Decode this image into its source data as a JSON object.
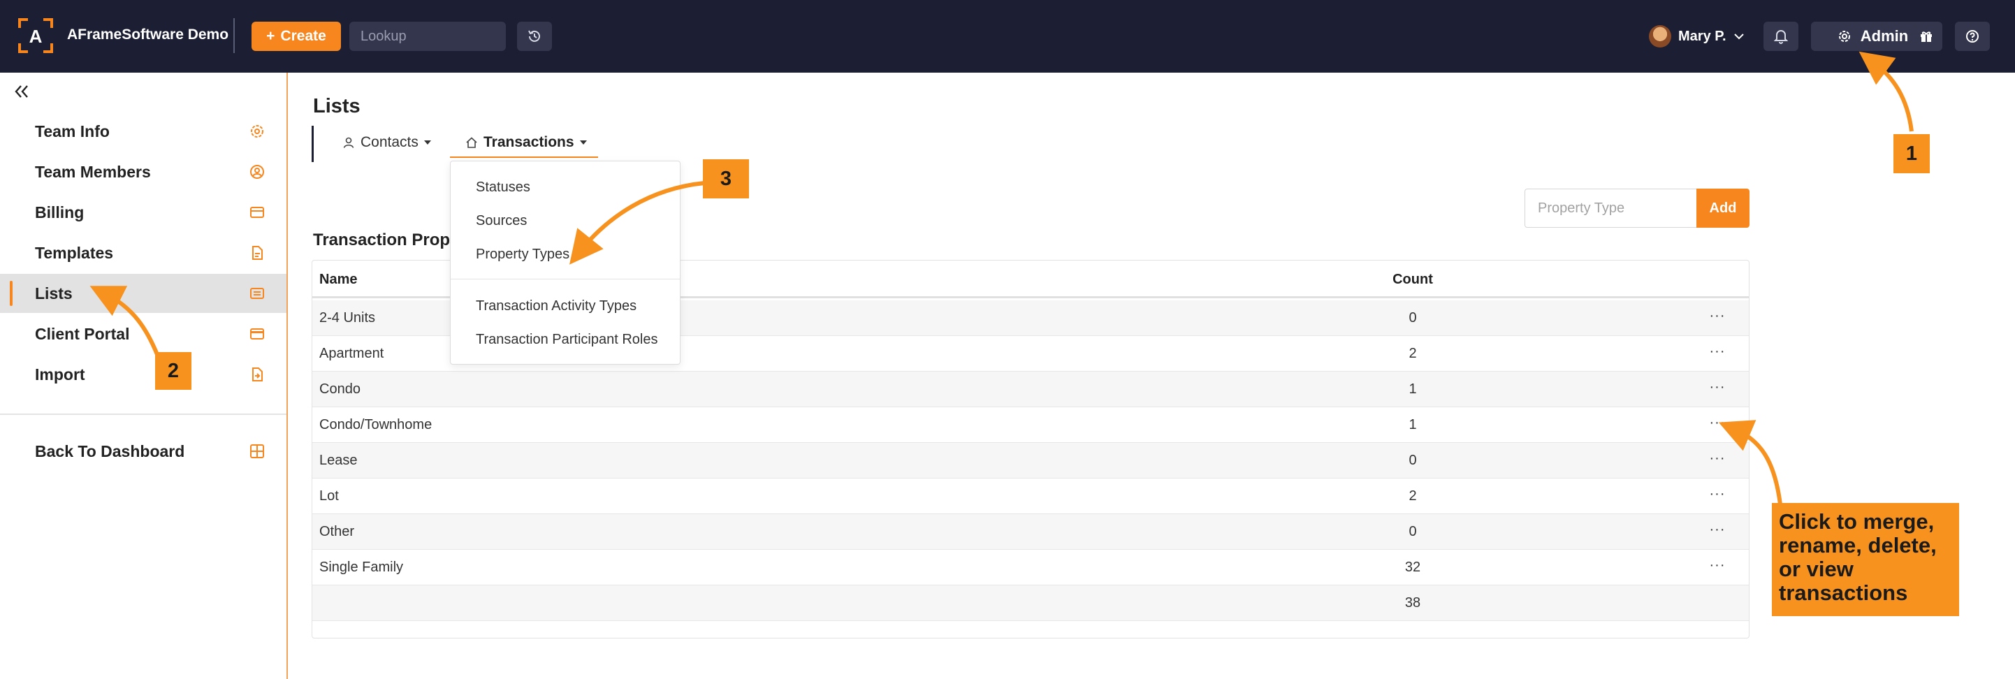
{
  "app": {
    "brand": "AFrameSoftware Demo",
    "create_label": "Create",
    "lookup_placeholder": "Lookup",
    "user_name": "Mary P.",
    "admin_label": "Admin"
  },
  "sidebar": {
    "items": [
      {
        "label": "Team Info",
        "icon": "gear-icon"
      },
      {
        "label": "Team Members",
        "icon": "user-circle-icon"
      },
      {
        "label": "Billing",
        "icon": "credit-card-icon"
      },
      {
        "label": "Templates",
        "icon": "document-icon"
      },
      {
        "label": "Lists",
        "icon": "list-icon"
      },
      {
        "label": "Client Portal",
        "icon": "card-icon"
      },
      {
        "label": "Import",
        "icon": "file-import-icon"
      }
    ],
    "back_label": "Back To Dashboard"
  },
  "main": {
    "title": "Lists",
    "tabs": [
      {
        "label": "Contacts"
      },
      {
        "label": "Transactions"
      }
    ],
    "dropdown": {
      "group1": [
        "Statuses",
        "Sources",
        "Property Types"
      ],
      "group2": [
        "Transaction Activity Types",
        "Transaction Participant Roles"
      ]
    },
    "section_title": "Transaction Property Types",
    "add": {
      "placeholder": "Property Type",
      "button_label": "Add"
    },
    "table": {
      "headers": [
        "Name",
        "Count"
      ],
      "rows": [
        {
          "name": "2-4 Units",
          "count": "0"
        },
        {
          "name": "Apartment",
          "count": "2"
        },
        {
          "name": "Condo",
          "count": "1"
        },
        {
          "name": "Condo/Townhome",
          "count": "1"
        },
        {
          "name": "Lease",
          "count": "0"
        },
        {
          "name": "Lot",
          "count": "2"
        },
        {
          "name": "Other",
          "count": "0"
        },
        {
          "name": "Single Family",
          "count": "32"
        }
      ],
      "total": "38",
      "more_glyph": "···"
    }
  },
  "annotations": {
    "step1": "1",
    "step2": "2",
    "step3": "3",
    "note": "Click to merge, rename, delete, or view transactions"
  },
  "colors": {
    "accent": "#f7861e",
    "topbar": "#1c1e33",
    "callout": "#f7921e"
  }
}
